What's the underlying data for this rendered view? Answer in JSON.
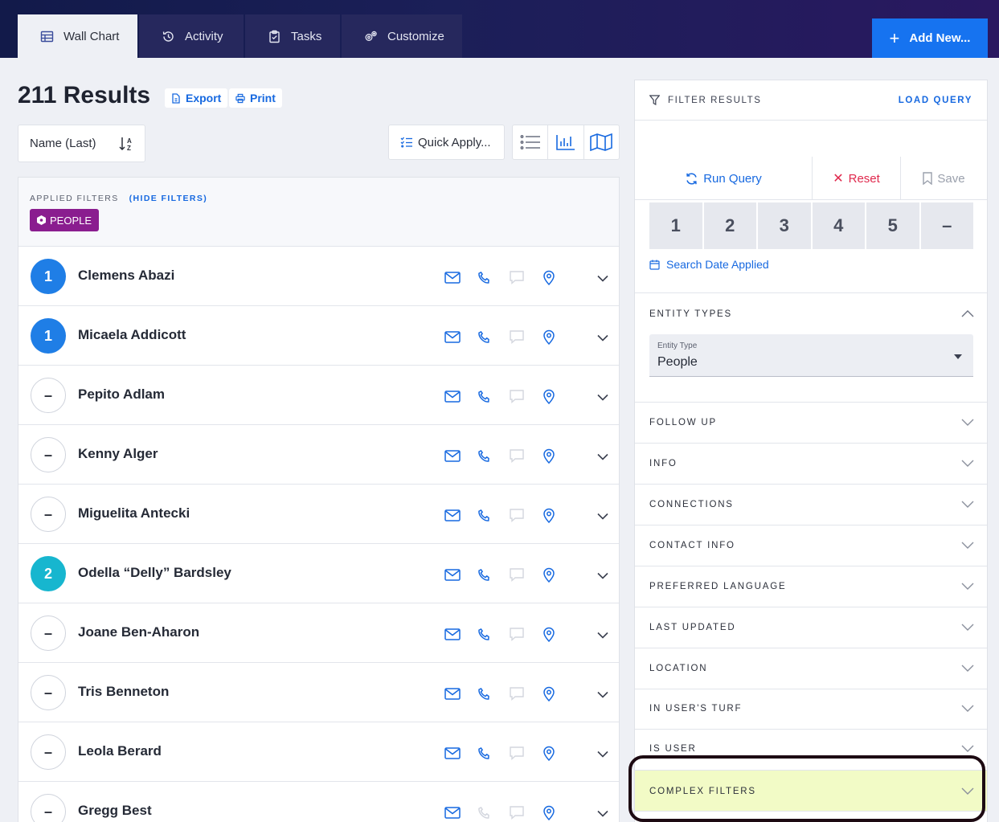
{
  "tabs": [
    {
      "label": "Wall Chart",
      "icon": "table-icon",
      "active": true
    },
    {
      "label": "Activity",
      "icon": "history-icon",
      "active": false
    },
    {
      "label": "Tasks",
      "icon": "clipboard-icon",
      "active": false
    },
    {
      "label": "Customize",
      "icon": "gears-icon",
      "active": false
    }
  ],
  "add_new_label": "Add New...",
  "results_title": "211 Results",
  "export_label": "Export",
  "print_label": "Print",
  "sort": {
    "value": "Name (Last)",
    "icon": "sort-az-icon"
  },
  "quick_apply_label": "Quick Apply...",
  "applied_filters": {
    "label": "APPLIED FILTERS",
    "hide_label": "(HIDE FILTERS)",
    "pill": "PEOPLE"
  },
  "rows": [
    {
      "badge": "1",
      "name": "Clemens Abazi"
    },
    {
      "badge": "1",
      "name": "Micaela Addicott"
    },
    {
      "badge": "–",
      "name": "Pepito Adlam"
    },
    {
      "badge": "–",
      "name": "Kenny Alger"
    },
    {
      "badge": "–",
      "name": "Miguelita Antecki"
    },
    {
      "badge": "2",
      "name": "Odella “Delly” Bardsley"
    },
    {
      "badge": "–",
      "name": "Joane Ben-Aharon"
    },
    {
      "badge": "–",
      "name": "Tris Benneton"
    },
    {
      "badge": "–",
      "name": "Leola Berard"
    },
    {
      "badge": "–",
      "name": "Gregg Best"
    }
  ],
  "filter_panel": {
    "title": "FILTER RESULTS",
    "load_query": "LOAD QUERY",
    "run_query": "Run Query",
    "reset": "Reset",
    "save": "Save",
    "numbers": [
      "1",
      "2",
      "3",
      "4",
      "5",
      "–"
    ],
    "search_date": "Search Date Applied",
    "entity_types": {
      "label": "ENTITY TYPES",
      "field_label": "Entity Type",
      "value": "People"
    },
    "sections": [
      "FOLLOW UP",
      "INFO",
      "CONNECTIONS",
      "CONTACT INFO",
      "PREFERRED LANGUAGE",
      "LAST UPDATED",
      "LOCATION",
      "IN USER'S TURF",
      "IS USER",
      "COMPLEX FILTERS"
    ]
  },
  "colors": {
    "accent": "#1673f0",
    "badge_blue": "#1f7ee6",
    "badge_teal": "#17b6cf",
    "pill_purple": "#8a1d8f",
    "highlight": "#f2fbc6",
    "reset_red": "#e0294d"
  }
}
